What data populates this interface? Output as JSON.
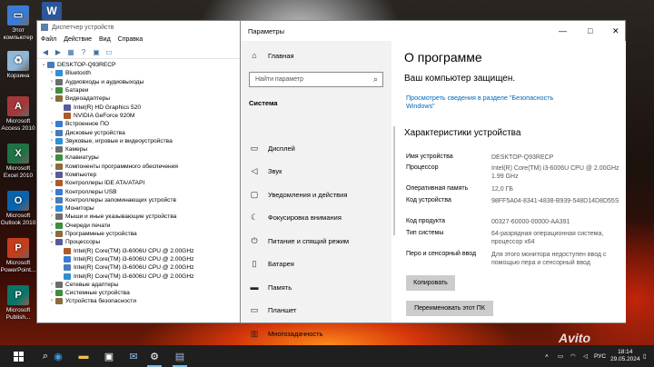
{
  "desktop": {
    "icons": [
      {
        "label": "Этот компьютер",
        "icon": "computer-icon",
        "color": "#3a7bd5"
      },
      {
        "label": "Корзина",
        "icon": "recycle-bin-icon",
        "color": "#8fb7d9"
      },
      {
        "label": "Microsoft Access 2010",
        "icon": "access-icon",
        "color": "#a4373a"
      },
      {
        "label": "Microsoft Excel 2010",
        "icon": "excel-icon",
        "color": "#1f7244"
      },
      {
        "label": "Microsoft Outlook 2010",
        "icon": "outlook-icon",
        "color": "#0a64ad"
      },
      {
        "label": "Microsoft PowerPoint...",
        "icon": "powerpoint-icon",
        "color": "#c43e1c"
      },
      {
        "label": "Microsoft Publish...",
        "icon": "publisher-icon",
        "color": "#077568"
      }
    ],
    "word_icon_color": "#2b579a"
  },
  "device_manager": {
    "title": "Диспетчер устройств",
    "menu": [
      "Файл",
      "Действие",
      "Вид",
      "Справка"
    ],
    "tree": [
      {
        "label": "DESKTOP-Q93RECP",
        "level": 0,
        "expanded": true
      },
      {
        "label": "Bluetooth",
        "level": 1,
        "expanded": false
      },
      {
        "label": "Аудиовходы и аудиовыходы",
        "level": 1,
        "expanded": false
      },
      {
        "label": "Батареи",
        "level": 1,
        "expanded": false
      },
      {
        "label": "Видеоадаптеры",
        "level": 1,
        "expanded": true
      },
      {
        "label": "Intel(R) HD Graphics 520",
        "level": 2,
        "expanded": null
      },
      {
        "label": "NVIDIA GeForce 920M",
        "level": 2,
        "expanded": null
      },
      {
        "label": "Встроенное ПО",
        "level": 1,
        "expanded": false
      },
      {
        "label": "Дисковые устройства",
        "level": 1,
        "expanded": false
      },
      {
        "label": "Звуковые, игровые и видеоустройства",
        "level": 1,
        "expanded": false
      },
      {
        "label": "Камеры",
        "level": 1,
        "expanded": false
      },
      {
        "label": "Клавиатуры",
        "level": 1,
        "expanded": false
      },
      {
        "label": "Компоненты программного обеспечения",
        "level": 1,
        "expanded": false
      },
      {
        "label": "Компьютер",
        "level": 1,
        "expanded": false
      },
      {
        "label": "Контроллеры IDE ATA/ATAPI",
        "level": 1,
        "expanded": false
      },
      {
        "label": "Контроллеры USB",
        "level": 1,
        "expanded": false
      },
      {
        "label": "Контроллеры запоминающих устройств",
        "level": 1,
        "expanded": false
      },
      {
        "label": "Мониторы",
        "level": 1,
        "expanded": false
      },
      {
        "label": "Мыши и иные указывающие устройства",
        "level": 1,
        "expanded": false
      },
      {
        "label": "Очереди печати",
        "level": 1,
        "expanded": false
      },
      {
        "label": "Программные устройства",
        "level": 1,
        "expanded": false
      },
      {
        "label": "Процессоры",
        "level": 1,
        "expanded": true
      },
      {
        "label": "Intel(R) Core(TM) i3-6006U CPU @ 2.00GHz",
        "level": 2,
        "expanded": null
      },
      {
        "label": "Intel(R) Core(TM) i3-6006U CPU @ 2.00GHz",
        "level": 2,
        "expanded": null
      },
      {
        "label": "Intel(R) Core(TM) i3-6006U CPU @ 2.00GHz",
        "level": 2,
        "expanded": null
      },
      {
        "label": "Intel(R) Core(TM) i3-6006U CPU @ 2.00GHz",
        "level": 2,
        "expanded": null
      },
      {
        "label": "Сетевые адаптеры",
        "level": 1,
        "expanded": false
      },
      {
        "label": "Системные устройства",
        "level": 1,
        "expanded": false
      },
      {
        "label": "Устройства безопасности",
        "level": 1,
        "expanded": false
      }
    ]
  },
  "settings": {
    "title": "Параметры",
    "window_controls": {
      "minimize": "—",
      "maximize": "□",
      "close": "✕"
    },
    "home_label": "Главная",
    "search_placeholder": "Найти параметр",
    "section_label": "Система",
    "nav": [
      {
        "label": "Дисплей",
        "icon": "display-icon"
      },
      {
        "label": "Звук",
        "icon": "sound-icon"
      },
      {
        "label": "Уведомления и действия",
        "icon": "notifications-icon"
      },
      {
        "label": "Фокусировка внимания",
        "icon": "focus-assist-icon"
      },
      {
        "label": "Питание и спящий режим",
        "icon": "power-icon"
      },
      {
        "label": "Батарея",
        "icon": "battery-icon"
      },
      {
        "label": "Память",
        "icon": "storage-icon"
      },
      {
        "label": "Планшет",
        "icon": "tablet-icon"
      },
      {
        "label": "Многозадачность",
        "icon": "multitasking-icon"
      }
    ],
    "page_title": "О программе",
    "protected_text": "Ваш компьютер защищен.",
    "security_link": "Просмотреть сведения в разделе \"Безопасность Windows\"",
    "specs_title": "Характеристики устройства",
    "specs": [
      {
        "label": "Имя устройства",
        "value": "DESKTOP-Q93RECP"
      },
      {
        "label": "Процессор",
        "value": "Intel(R) Core(TM) i3-6006U CPU @ 2.00GHz   1.99 GHz"
      },
      {
        "label": "Оперативная память",
        "value": "12,0 ГБ"
      },
      {
        "label": "Код устройства",
        "value": "98FF5A04-8341-4838-B939-548D14D8D55S"
      },
      {
        "label": "Код продукта",
        "value": "00327-60000-00000-AA391"
      },
      {
        "label": "Тип системы",
        "value": "64-разрядная операционная система, процессор x64"
      },
      {
        "label": "Перо и сенсорный ввод",
        "value": "Для этого монитора недоступен ввод с помощью пера и сенсорный ввод"
      }
    ],
    "copy_button": "Копировать",
    "rename_button": "Переименовать этот ПК",
    "accent_color": "#0067b8"
  },
  "taskbar": {
    "apps": [
      "start-icon",
      "search-icon",
      "edge-icon",
      "explorer-icon",
      "store-icon",
      "settings-icon",
      "device-manager-icon"
    ],
    "language": "РУС",
    "time": "18:14",
    "date": "29.05.2024"
  },
  "watermark": "Avito"
}
